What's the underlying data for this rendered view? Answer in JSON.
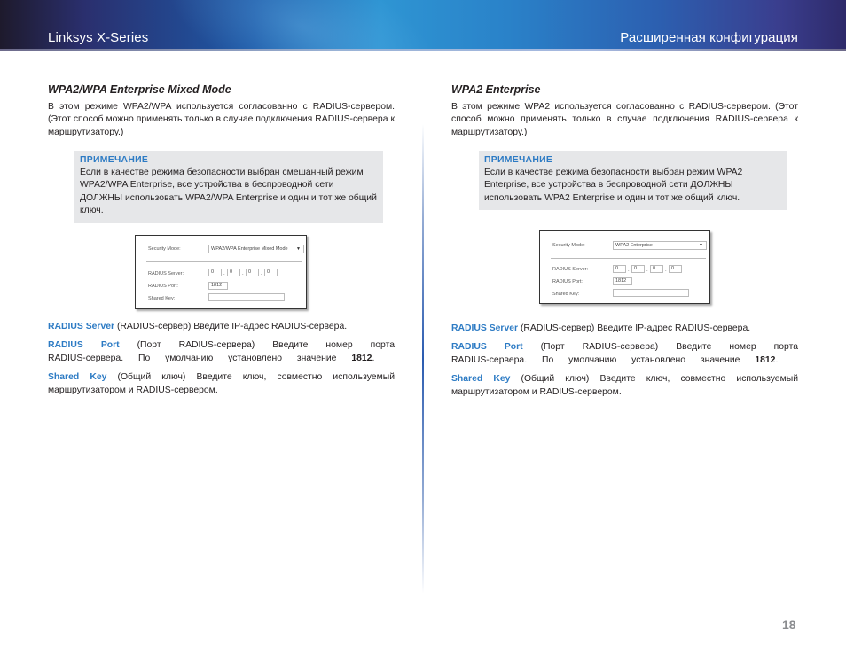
{
  "header": {
    "left_title": "Linksys X-Series",
    "right_title": "Расширенная конфигурация"
  },
  "left": {
    "title": "WPA2/WPA Enterprise Mixed Mode",
    "intro": "В этом режиме WPA2/WPA используется согласованно с RADIUS-сервером. (Этот способ можно применять только в случае подключения RADIUS-сервера к маршрутизатору.)",
    "note": {
      "title": "ПРИМЕЧАНИЕ",
      "text": "Если в качестве режима безопасности выбран смешанный режим WPA2/WPA Enterprise, все устройства в беспроводной сети ДОЛЖНЫ использовать WPA2/WPA Enterprise и один и тот же общий ключ."
    },
    "screenshot": {
      "security_mode_label": "Security Mode:",
      "security_mode_value": "WPA2/WPA Enterprise Mixed Mode",
      "radius_server_label": "RADIUS Server:",
      "radius_server_octets": [
        "0",
        "0",
        "0",
        "0"
      ],
      "radius_port_label": "RADIUS Port:",
      "radius_port_value": "1812",
      "shared_key_label": "Shared Key:",
      "shared_key_value": ""
    },
    "definitions": [
      {
        "term": "RADIUS Server",
        "text": " (RADIUS-сервер)  Введите IP-адрес RADIUS-сервера."
      },
      {
        "term": "RADIUS Port",
        "text_before": " (Порт RADIUS-сервера) Введите номер порта RADIUS-сервера. По умолчанию установлено значение ",
        "bold": "1812",
        "text_after": "."
      },
      {
        "term": "Shared Key",
        "text": " (Общий ключ) Введите ключ, совместно используемый маршрутизатором и RADIUS-сервером."
      }
    ]
  },
  "right": {
    "title": "WPA2 Enterprise",
    "intro": "В этом режиме WPA2 используется согласованно с RADIUS-сервером. (Этот способ можно применять только в случае подключения RADIUS-сервера к маршрутизатору.)",
    "note": {
      "title": "ПРИМЕЧАНИЕ",
      "text": "Если в качестве режима безопасности выбран режим WPA2 Enterprise, все устройства в беспроводной сети ДОЛЖНЫ использовать WPA2 Enterprise и один и тот же общий ключ."
    },
    "screenshot": {
      "security_mode_label": "Security Mode:",
      "security_mode_value": "WPA2 Enterprise",
      "radius_server_label": "RADIUS Server:",
      "radius_server_octets": [
        "0",
        "0",
        "0",
        "0"
      ],
      "radius_port_label": "RADIUS Port:",
      "radius_port_value": "1812",
      "shared_key_label": "Shared Key:",
      "shared_key_value": ""
    },
    "definitions": [
      {
        "term": "RADIUS Server",
        "text": " (RADIUS-сервер)  Введите IP-адрес RADIUS-сервера."
      },
      {
        "term": "RADIUS Port",
        "text_before": " (Порт RADIUS-сервера) Введите номер порта RADIUS-сервера. По умолчанию установлено значение ",
        "bold": "1812",
        "text_after": "."
      },
      {
        "term": "Shared Key",
        "text": " (Общий ключ) Введите ключ, совместно используемый маршрутизатором и RADIUS-сервером."
      }
    ]
  },
  "footer": {
    "page_number": "18"
  },
  "colors": {
    "accent_blue": "#2d7bc4",
    "note_background": "#e6e7e9",
    "page_number_gray": "#8a8c8f"
  }
}
